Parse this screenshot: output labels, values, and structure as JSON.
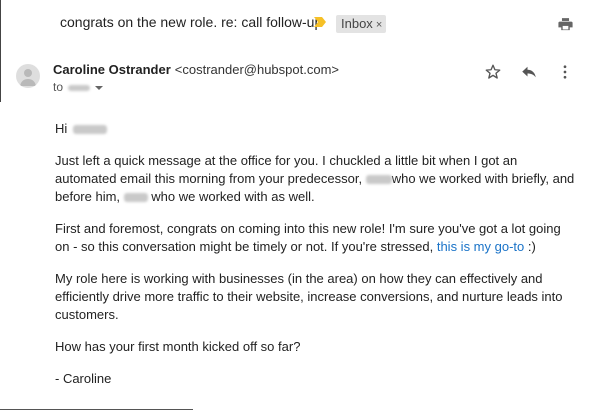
{
  "thread": {
    "subject": "congrats on the new role. re: call follow-up",
    "label": "Inbox",
    "label_close": "×",
    "important_icon": "importance-marker-icon",
    "print_icon": "print-icon"
  },
  "message": {
    "sender_name": "Caroline Ostrander",
    "sender_email": "<costrander@hubspot.com>",
    "to_label": "to",
    "actions": [
      "star-icon",
      "reply-icon",
      "more-icon"
    ]
  },
  "body": {
    "greeting": "Hi",
    "p1_a": "Just left a quick message at the office for you. I chuckled a little bit when I got an automated email this morning from your predecessor,",
    "p1_b": "who we worked with briefly, and before him,",
    "p1_c": "who we worked with as well.",
    "p2_a": "First and foremost, congrats on coming into this new role! I'm sure you've got a lot going on - so this conversation might be timely or not. If you're stressed,",
    "p2_link": "this is my go-to",
    "p2_b": ":)",
    "p3": "My role here is working with businesses (in the area) on how they can effectively and efficiently drive more traffic to their website, increase conversions, and nurture leads into customers.",
    "p4": "How has your first month kicked off so far?",
    "signoff": "- Caroline"
  },
  "colors": {
    "accent_link": "#1a73c8",
    "importance": "#f6c026",
    "chip_bg": "#e3e3e3"
  }
}
